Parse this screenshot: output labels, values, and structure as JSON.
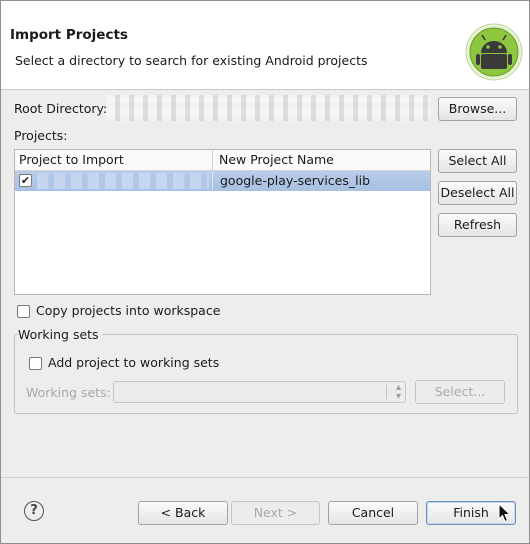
{
  "header": {
    "title": "Import Projects",
    "subtitle": "Select a directory to search for existing Android projects",
    "logo_icon": "android-logo-icon",
    "logo_color": "#8ec63f"
  },
  "root_directory": {
    "label": "Root Directory:",
    "browse_label": "Browse..."
  },
  "projects": {
    "label": "Projects:",
    "columns": [
      "Project to Import",
      "New Project Name"
    ],
    "rows": [
      {
        "checked": true,
        "new_name": "google-play-services_lib"
      }
    ],
    "select_all_label": "Select All",
    "deselect_all_label": "Deselect All",
    "refresh_label": "Refresh",
    "selection_color": "#b3c8e6"
  },
  "copy_into_workspace": {
    "label": "Copy projects into workspace",
    "checked": false
  },
  "working_sets": {
    "group_label": "Working sets",
    "add_label": "Add project to working sets",
    "add_checked": false,
    "field_label": "Working sets:",
    "select_label": "Select..."
  },
  "footer": {
    "help_icon": "help-icon",
    "help_glyph": "?",
    "back_label": "< Back",
    "next_label": "Next >",
    "cancel_label": "Cancel",
    "finish_label": "Finish"
  }
}
